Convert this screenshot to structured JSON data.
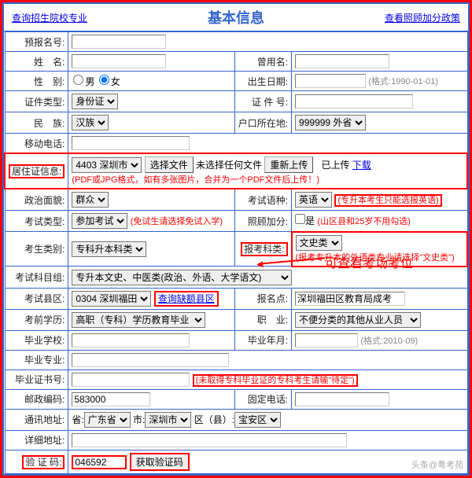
{
  "header": {
    "left_link": "查询招生院校专业",
    "title": "基本信息",
    "right_link": "查看照顾加分政策"
  },
  "rows": {
    "prereg": {
      "label": "预报名号:",
      "val": ""
    },
    "name": {
      "label": "姓　名:",
      "val": ""
    },
    "former_name": {
      "label": "曾用名:",
      "val": ""
    },
    "gender": {
      "label": "性　别:",
      "male": "男",
      "female": "女"
    },
    "birth": {
      "label": "出生日期:",
      "val": "",
      "hint": "(格式:1990-01-01)"
    },
    "idtype": {
      "label": "证件类型:",
      "opt": "身份证"
    },
    "idno": {
      "label": "证 件 号:",
      "val": ""
    },
    "nation": {
      "label": "民　族:",
      "opt": "汉族"
    },
    "hukou": {
      "label": "户口所在地:",
      "opt": "999999 外省"
    },
    "mobile": {
      "label": "移动电话:",
      "val": ""
    },
    "residence": {
      "label": "居住证信息:",
      "opt": "4403 深圳市",
      "filebtn": "选择文件",
      "nofile": "未选择任何文件",
      "rebtn": "重新上传",
      "uploaded": "已上传",
      "download": "下载",
      "hint": "(PDF或JPG格式，如有多张图片，合并为一个PDF文件后上传！)"
    },
    "politics": {
      "label": "政治面貌:",
      "opt": "群众"
    },
    "examlang": {
      "label": "考试语种:",
      "opt": "英语",
      "hint": "(专升本考生只能选报英语)"
    },
    "examtype": {
      "label": "考试类型:",
      "opt": "参加考试",
      "hint": "(免试生请选择免试入学)"
    },
    "bonus": {
      "label": "照顾加分:",
      "cb": "是",
      "hint": "(山区县和25岁不用勾选)"
    },
    "stutype": {
      "label": "考生类别:",
      "opt": "专科升本科类"
    },
    "subject": {
      "label": "报考科类:",
      "opt": "文史类",
      "hint": "(报考专升本的外语类专业请选择\"文史类\")"
    },
    "subjectgroup": {
      "label": "考试科目组:",
      "opt": "专升本文史、中医类(政治、外语、大学语文)"
    },
    "district": {
      "label": "考试县区:",
      "opt": "0304 深圳福田",
      "link": "查询缺额县区"
    },
    "site": {
      "label": "报名点:",
      "val": "深圳福田区教育局成考"
    },
    "preedu": {
      "label": "考前学历:",
      "opt": "高职（专科）学历教育毕业"
    },
    "job": {
      "label": "职　业:",
      "opt": "不便分类的其他从业人员"
    },
    "gradschool": {
      "label": "毕业学校:",
      "val": ""
    },
    "gradyear": {
      "label": "毕业年月:",
      "val": "",
      "hint": "(格式:2010-09)"
    },
    "major": {
      "label": "毕业专业:",
      "val": ""
    },
    "cert": {
      "label": "毕业证书号:",
      "val": "",
      "hint": "(未取得专科毕业证的专科考生请输\"待定\")"
    },
    "zip": {
      "label": "邮政编码:",
      "val": "583000"
    },
    "phone": {
      "label": "固定电话:",
      "val": ""
    },
    "addr": {
      "label": "通讯地址:",
      "prov": "省:",
      "prov_opt": "广东省",
      "city": "市:",
      "city_opt": "深圳市",
      "county": "区（县）:",
      "county_opt": "宝安区"
    },
    "detailaddr": {
      "label": "详细地址:",
      "val": ""
    },
    "captcha": {
      "label": "验 证 码:",
      "val": "046592",
      "btn": "获取验证码"
    }
  },
  "annotation": "可查看考场考位",
  "watermark": "头条@粤考苑"
}
